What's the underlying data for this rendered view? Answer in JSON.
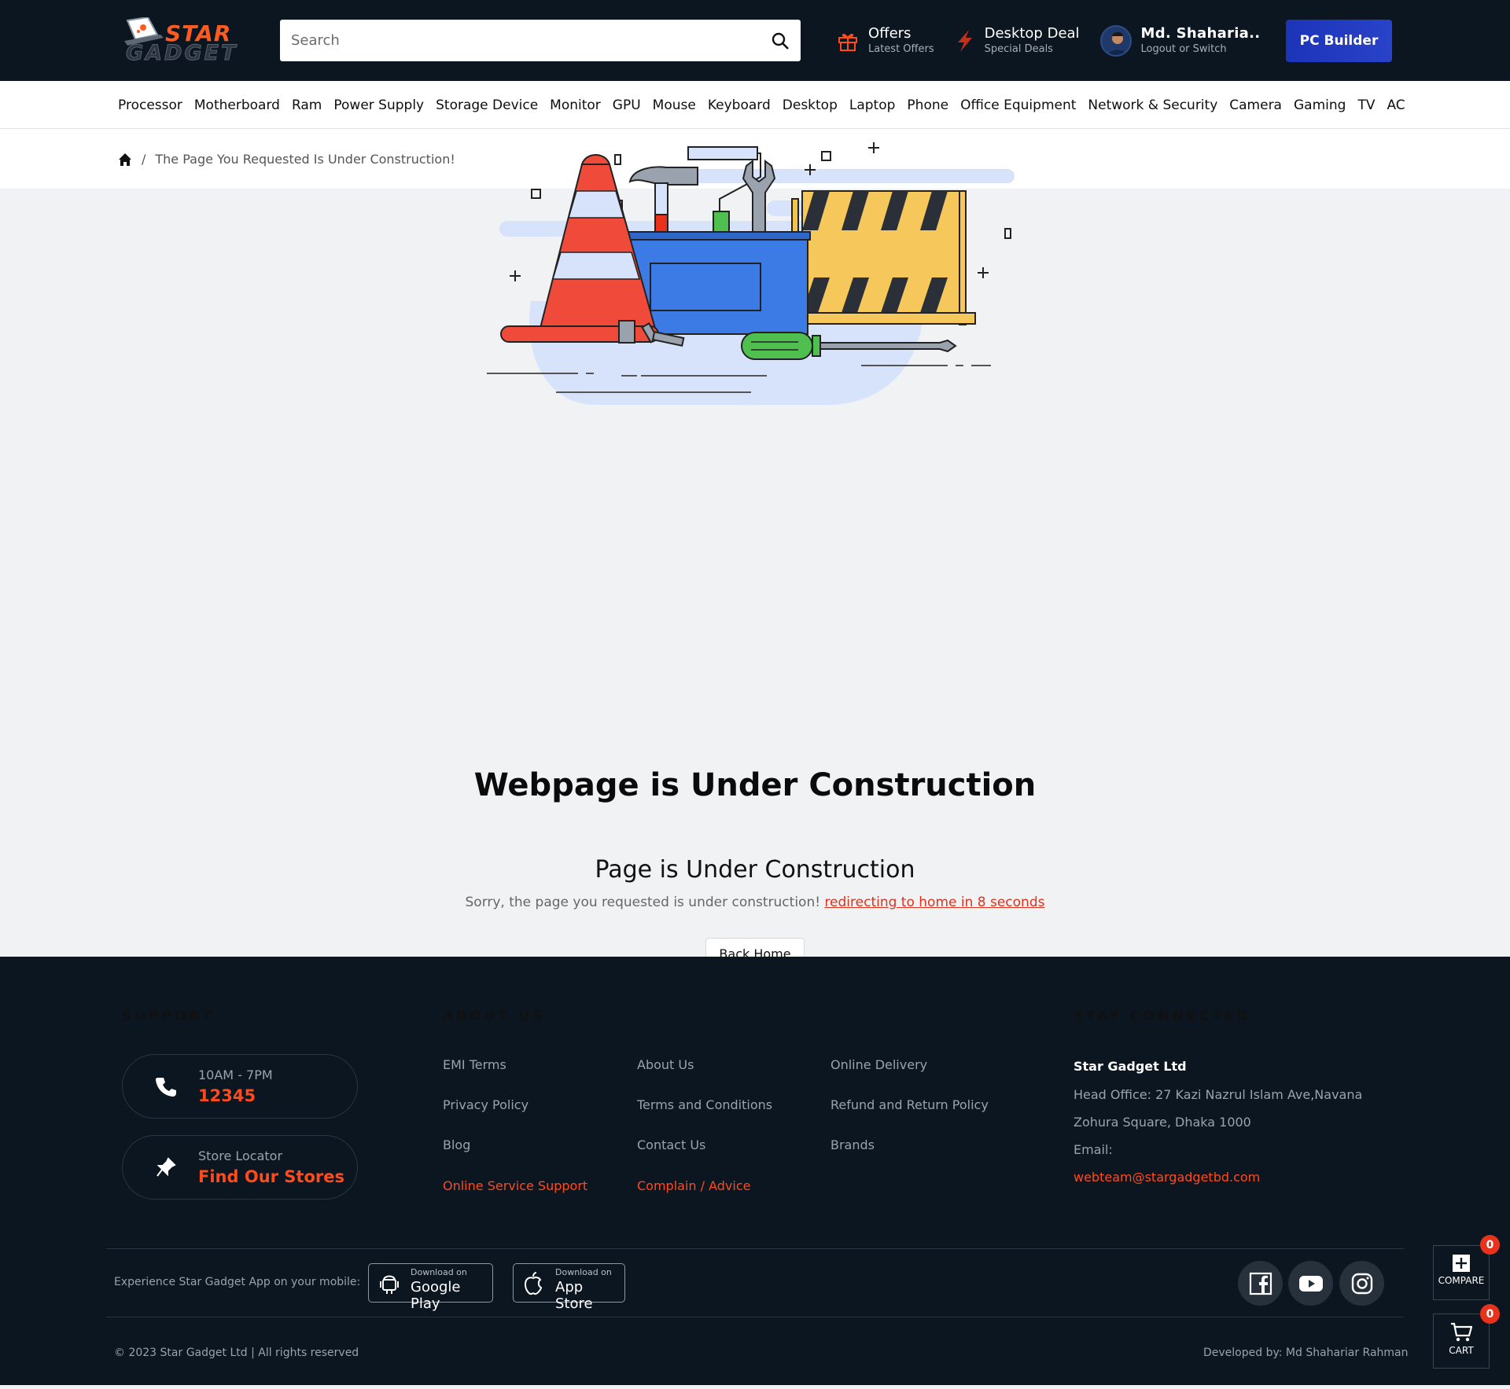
{
  "header": {
    "logo_top": "STAR",
    "logo_bottom": "GADGET",
    "search_placeholder": "Search",
    "offers_title": "Offers",
    "offers_sub": "Latest Offers",
    "deal_title": "Desktop Deal",
    "deal_sub": "Special Deals",
    "user_name": "Md. Shaharia..",
    "user_sub": "Logout or Switch",
    "pc_builder": "PC Builder"
  },
  "nav": [
    "Processor",
    "Motherboard",
    "Ram",
    "Power Supply",
    "Storage Device",
    "Monitor",
    "GPU",
    "Mouse",
    "Keyboard",
    "Desktop",
    "Laptop",
    "Phone",
    "Office Equipment",
    "Network & Security",
    "Camera",
    "Gaming",
    "TV",
    "AC"
  ],
  "breadcrumb": {
    "current": "The Page You Requested Is Under Construction!",
    "sep": "/"
  },
  "main": {
    "heading": "Webpage is Under Construction",
    "subheading": "Page is Under Construction",
    "message": "Sorry, the page you requested is under construction!",
    "redirect": "redirecting to home in 8 seconds",
    "back_button": "Back Home"
  },
  "footer": {
    "support_title": "SUPPORT",
    "hours": "10AM - 7PM",
    "phone": "12345",
    "store_label": "Store Locator",
    "store_link": "Find Our Stores",
    "about_title": "ABOUT US",
    "links_col1": [
      "EMI Terms",
      "Privacy Policy",
      "Blog",
      "Online Service Support"
    ],
    "links_col2": [
      "About Us",
      "Terms and Conditions",
      "Contact Us",
      "Complain / Advice"
    ],
    "links_col3": [
      "Online Delivery",
      "Refund and Return Policy",
      "Brands"
    ],
    "connect_title": "STAY CONNECTED",
    "company": "Star Gadget Ltd",
    "address1": "Head Office: 27 Kazi Nazrul Islam Ave,Navana",
    "address2": "Zohura Square, Dhaka 1000",
    "email_label": "Email:",
    "email": "webteam@stargadgetbd.com",
    "app_text": "Experience Star Gadget App on your mobile:",
    "gplay_small": "Download on",
    "gplay": "Google Play",
    "appstore_small": "Download on",
    "appstore": "App Store",
    "copyright": "© 2023 Star Gadget Ltd | All rights reserved",
    "developer": "Developed by: Md Shahariar Rahman"
  },
  "floating": {
    "compare_label": "COMPARE",
    "compare_count": "0",
    "cart_label": "CART",
    "cart_count": "0"
  },
  "colors": {
    "header_bg": "#0c1620",
    "accent": "#ff4a1c",
    "pc_builder": "#2238c2"
  }
}
